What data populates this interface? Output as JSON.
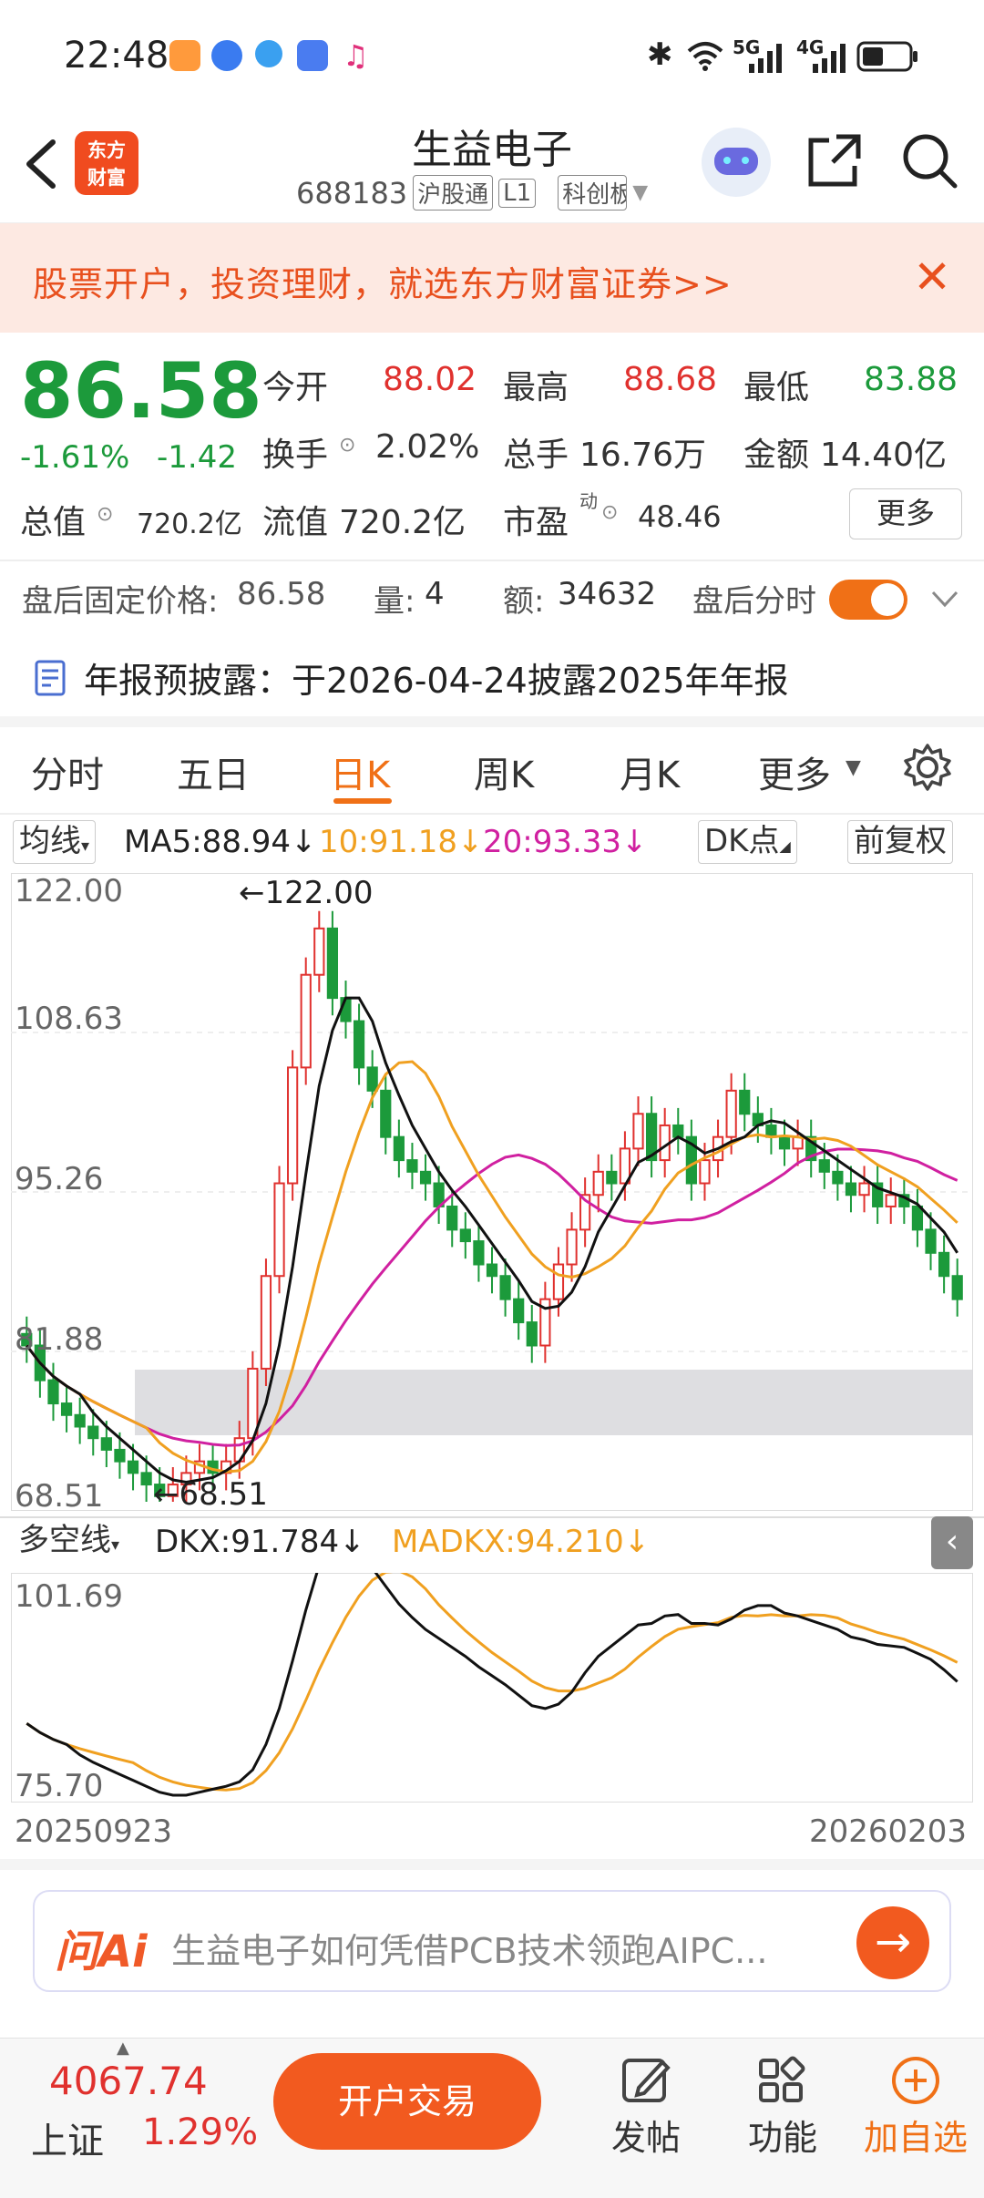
{
  "status_bar": {
    "time": "22:48",
    "icons": [
      "bluetooth-icon",
      "wifi-icon",
      "5g-signal-icon",
      "4g-signal-icon",
      "battery-icon"
    ],
    "net1": "5G",
    "net2": "4G"
  },
  "header": {
    "logo_text": "东方财富",
    "title": "生益电子",
    "code": "688183",
    "tag1": "沪股通",
    "tag2": "L1",
    "tag3": "科创板"
  },
  "banner": {
    "text": "股票开户，投资理财，就选东方财富证券>>",
    "close": "✕"
  },
  "quote": {
    "price": "86.58",
    "change_pct": "-1.61%",
    "change": "-1.42",
    "open_label": "今开",
    "open": "88.02",
    "high_label": "最高",
    "high": "88.68",
    "low_label": "最低",
    "low": "83.88",
    "turnover_label": "换手",
    "turnover": "2.02%",
    "volume_label": "总手",
    "volume": "16.76万",
    "amount_label": "金额",
    "amount": "14.40亿",
    "mktcap_label": "总值",
    "mktcap": "720.2亿",
    "float_label": "流值",
    "float": "720.2亿",
    "pe_label": "市盈",
    "pe_sup": "动",
    "pe": "48.46",
    "more": "更多"
  },
  "after_hours": {
    "label": "盘后固定价格:",
    "price": "86.58",
    "vol_label": "量:",
    "vol": "4",
    "amt_label": "额:",
    "amt": "34632",
    "intraday_label": "盘后分时"
  },
  "notice": {
    "text": "年报预披露：于2026-04-24披露2025年年报"
  },
  "tabs": [
    "分时",
    "五日",
    "日K",
    "周K",
    "月K",
    "更多"
  ],
  "ma_row": {
    "select": "均线",
    "ma5": "MA5:88.94↓",
    "ma10": "10:91.18↓",
    "ma20": "20:93.33↓",
    "dk": "DK点",
    "adjust": "前复权"
  },
  "kchart_axis": {
    "y1": "122.00",
    "y2": "108.63",
    "y3": "95.26",
    "y4": "81.88",
    "y5": "68.51",
    "max_label": "←122.00",
    "min_label": "←68.51"
  },
  "dk_row": {
    "select": "多空线",
    "dkx": "DKX:91.784↓",
    "madkx": "MADKX:94.210↓"
  },
  "dchart_axis": {
    "y1": "101.69",
    "y2": "75.70"
  },
  "x_axis": {
    "start": "20250923",
    "end": "20260203"
  },
  "ai": {
    "logo": "问Ai",
    "text": "生益电子如何凭借PCB技术领跑AIPC..."
  },
  "bottom": {
    "index_value": "4067.74",
    "index_name": "上证",
    "index_pct": "1.29%",
    "trade": "开户交易",
    "post": "发帖",
    "func": "功能",
    "watch": "加自选"
  },
  "chart_data": {
    "type": "candlestick",
    "ylim": [
      68.51,
      122.0
    ],
    "close_approx": [
      82,
      79,
      77,
      76,
      75,
      74,
      73,
      72,
      71,
      70,
      69,
      70,
      71,
      72,
      71,
      72,
      74,
      80,
      88,
      96,
      106,
      114,
      118,
      112,
      110,
      106,
      104,
      100,
      98,
      97,
      96,
      94,
      92,
      91,
      89,
      88,
      86,
      84,
      82,
      86,
      89,
      92,
      95,
      97,
      96,
      99,
      102,
      98,
      101,
      100,
      96,
      98,
      100,
      104,
      102,
      101,
      100,
      99,
      100,
      98,
      97,
      96,
      95,
      96,
      94,
      95,
      94,
      92,
      90,
      88,
      86
    ],
    "colors": {
      "up": "#e0312e",
      "down": "#1c9a3b",
      "ma5": "#111111",
      "ma10": "#f0a020",
      "ma20": "#d020a0",
      "dkx": "#111111",
      "madkx": "#f0a020"
    }
  }
}
